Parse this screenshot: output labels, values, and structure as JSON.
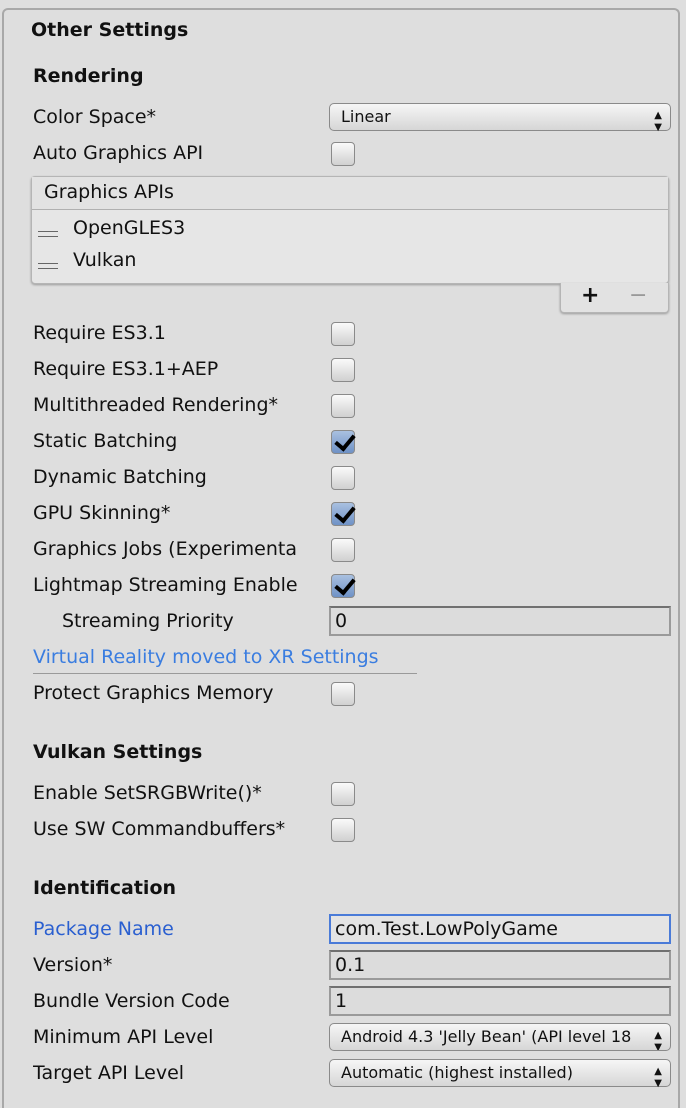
{
  "title": "Other Settings",
  "rendering": {
    "heading": "Rendering",
    "color_space": {
      "label": "Color Space*",
      "value": "Linear"
    },
    "auto_graphics_api": {
      "label": "Auto Graphics API",
      "checked": false
    },
    "graphics_apis": {
      "header": "Graphics APIs",
      "items": [
        "OpenGLES3",
        "Vulkan"
      ],
      "add": "+",
      "remove": "−"
    },
    "toggles": [
      {
        "label": "Require ES3.1",
        "checked": false
      },
      {
        "label": "Require ES3.1+AEP",
        "checked": false
      },
      {
        "label": "Multithreaded Rendering*",
        "checked": false
      },
      {
        "label": "Static Batching",
        "checked": true
      },
      {
        "label": "Dynamic Batching",
        "checked": false
      },
      {
        "label": "GPU Skinning*",
        "checked": true
      },
      {
        "label": "Graphics Jobs (Experimenta",
        "checked": false
      },
      {
        "label": "Lightmap Streaming Enable",
        "checked": true
      }
    ],
    "streaming_priority": {
      "label": "Streaming Priority",
      "value": "0"
    },
    "vr_link": "Virtual Reality moved to XR Settings",
    "protect_memory": {
      "label": "Protect Graphics Memory",
      "checked": false
    }
  },
  "vulkan": {
    "heading": "Vulkan Settings",
    "srgb": {
      "label": "Enable SetSRGBWrite()*",
      "checked": false
    },
    "sw_cmd": {
      "label": "Use SW Commandbuffers*",
      "checked": false
    }
  },
  "identification": {
    "heading": "Identification",
    "package_name": {
      "label": "Package Name",
      "value": "com.Test.LowPolyGame"
    },
    "version": {
      "label": "Version*",
      "value": "0.1"
    },
    "bundle_code": {
      "label": "Bundle Version Code",
      "value": "1"
    },
    "min_api": {
      "label": "Minimum API Level",
      "value": "Android 4.3 'Jelly Bean' (API level 18"
    },
    "target_api": {
      "label": "Target API Level",
      "value": "Automatic (highest installed)"
    }
  },
  "colors": {
    "link": "#3a7de0",
    "focus": "#4a7bd8",
    "check": "#7f9fcf"
  }
}
